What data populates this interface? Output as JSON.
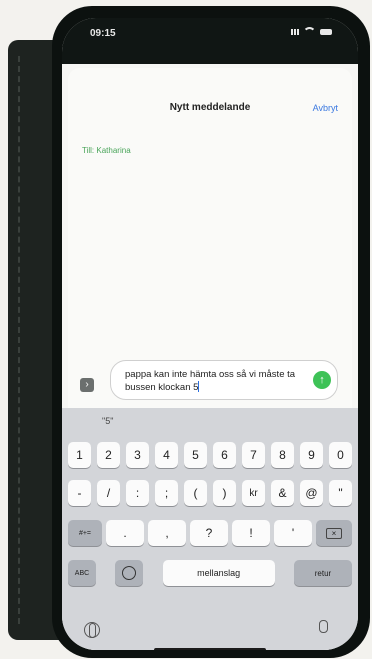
{
  "status": {
    "time": "09:15"
  },
  "nav": {
    "title": "Nytt meddelande",
    "cancel": "Avbryt"
  },
  "recipient": {
    "label": "Till:",
    "name": "Katharina"
  },
  "message": {
    "text": "pappa kan inte hämta oss så vi måste ta bussen klockan 5"
  },
  "keyboard": {
    "suggestion": "\"5\"",
    "row1": [
      "1",
      "2",
      "3",
      "4",
      "5",
      "6",
      "7",
      "8",
      "9",
      "0"
    ],
    "row2": [
      "-",
      "/",
      ":",
      ";",
      "(",
      ")",
      "kr",
      "&",
      "@",
      "\""
    ],
    "more_key": "#+=",
    "row3": [
      ".",
      ",",
      "?",
      "!",
      "'"
    ],
    "abc_key": "ABC",
    "space": "mellanslag",
    "return": "retur"
  },
  "colors": {
    "accent": "#3a78e0",
    "send": "#3ec257"
  }
}
